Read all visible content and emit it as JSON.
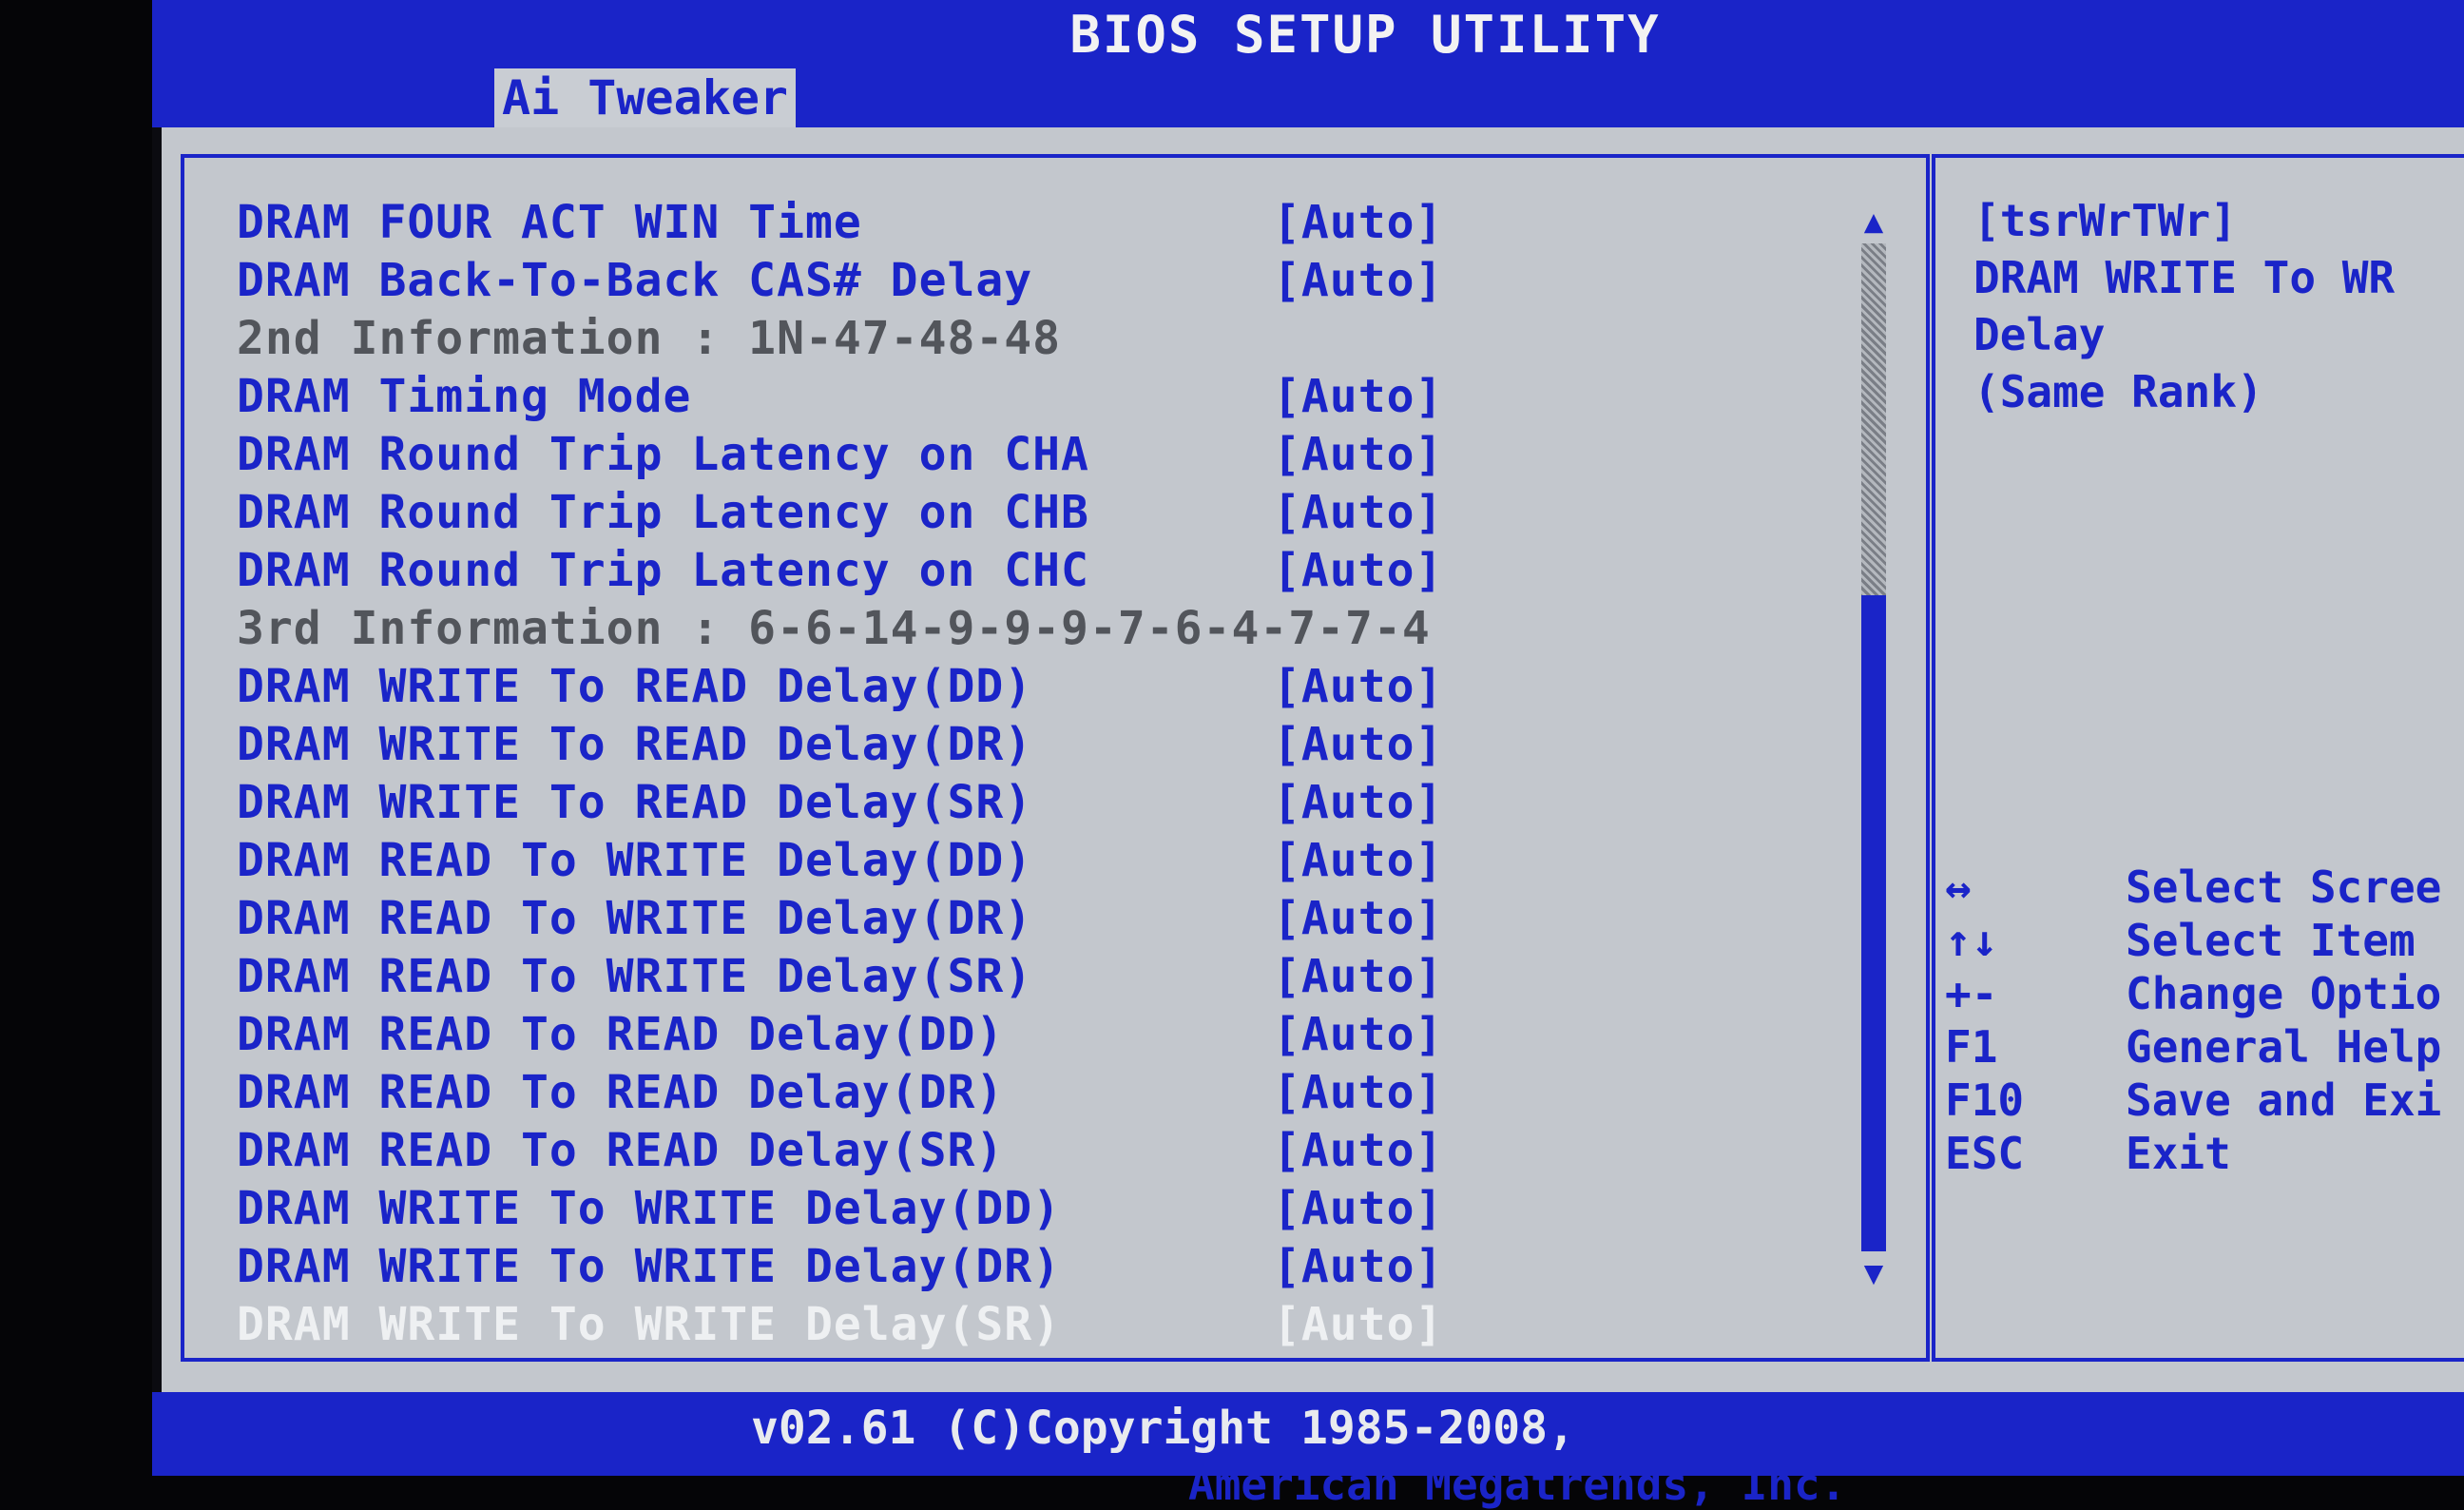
{
  "title": "BIOS SETUP UTILITY",
  "menu": {
    "active_tab": "Ai Tweaker"
  },
  "settings": [
    {
      "label": "DRAM FOUR ACT WIN Time",
      "value": "[Auto]",
      "type": "option"
    },
    {
      "label": "DRAM Back-To-Back CAS# Delay",
      "value": "[Auto]",
      "type": "option"
    },
    {
      "label": "2nd Information : 1N-47-48-48",
      "value": "",
      "type": "info"
    },
    {
      "label": "DRAM Timing Mode",
      "value": "[Auto]",
      "type": "option"
    },
    {
      "label": "DRAM Round Trip Latency on CHA",
      "value": "[Auto]",
      "type": "option"
    },
    {
      "label": "DRAM Round Trip Latency on CHB",
      "value": "[Auto]",
      "type": "option"
    },
    {
      "label": "DRAM Round Trip Latency on CHC",
      "value": "[Auto]",
      "type": "option"
    },
    {
      "label": "3rd Information : 6-6-14-9-9-9-7-6-4-7-7-4",
      "value": "",
      "type": "info"
    },
    {
      "label": "DRAM WRITE To READ Delay(DD)",
      "value": "[Auto]",
      "type": "option"
    },
    {
      "label": "DRAM WRITE To READ Delay(DR)",
      "value": "[Auto]",
      "type": "option"
    },
    {
      "label": "DRAM WRITE To READ Delay(SR)",
      "value": "[Auto]",
      "type": "option"
    },
    {
      "label": "DRAM READ To WRITE Delay(DD)",
      "value": "[Auto]",
      "type": "option"
    },
    {
      "label": "DRAM READ To WRITE Delay(DR)",
      "value": "[Auto]",
      "type": "option"
    },
    {
      "label": "DRAM READ To WRITE Delay(SR)",
      "value": "[Auto]",
      "type": "option"
    },
    {
      "label": "DRAM READ To READ Delay(DD)",
      "value": "[Auto]",
      "type": "option"
    },
    {
      "label": "DRAM READ To READ Delay(DR)",
      "value": "[Auto]",
      "type": "option"
    },
    {
      "label": "DRAM READ To READ Delay(SR)",
      "value": "[Auto]",
      "type": "option"
    },
    {
      "label": "DRAM WRITE To WRITE Delay(DD)",
      "value": "[Auto]",
      "type": "option"
    },
    {
      "label": "DRAM WRITE To WRITE Delay(DR)",
      "value": "[Auto]",
      "type": "option"
    },
    {
      "label": "DRAM WRITE To WRITE Delay(SR)",
      "value": "[Auto]",
      "type": "selected"
    }
  ],
  "help": {
    "lines": [
      "[tsrWrTWr]",
      "DRAM WRITE To WR",
      "Delay",
      "(Same Rank)"
    ]
  },
  "keys": [
    {
      "key": "↔",
      "desc": "Select Scree"
    },
    {
      "key": "↑↓",
      "desc": "Select Item"
    },
    {
      "key": "+-",
      "desc": "Change Optio"
    },
    {
      "key": "F1",
      "desc": "General Help"
    },
    {
      "key": "F10",
      "desc": "Save and Exi"
    },
    {
      "key": "ESC",
      "desc": "Exit"
    }
  ],
  "footer": {
    "copyright": "American Megatrends, Inc.",
    "version": "v02.61 (C)Copyright 1985-2008,"
  },
  "colors": {
    "bios_blue": "#1a24c8",
    "panel_gray": "#c3c7cd",
    "info_gray": "#52555b",
    "highlight": "#eef0f2"
  }
}
